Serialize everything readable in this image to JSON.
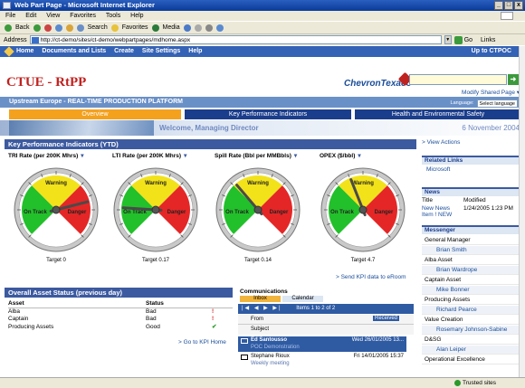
{
  "window": {
    "title": "Web Part Page - Microsoft Internet Explorer"
  },
  "menu": [
    "File",
    "Edit",
    "View",
    "Favorites",
    "Tools",
    "Help"
  ],
  "toolbar": {
    "back": "Back",
    "search": "Search",
    "favorites": "Favorites",
    "media": "Media"
  },
  "address": {
    "label": "Address",
    "url": "http://ct-demo/sites/ct-demo/webpartpages/mdhome.aspx",
    "go": "Go",
    "links": "Links"
  },
  "topnav": {
    "items": [
      "Home",
      "Documents and Lists",
      "Create",
      "Site Settings",
      "Help"
    ],
    "up": "Up to CTPOC"
  },
  "brand": {
    "title": "CTUE - RtPP",
    "logo_text": "ChevronTexaco"
  },
  "modify": "Modify Shared Page ▾",
  "platform": {
    "title": "Upstream Europe - REAL-TIME PRODUCTION PLATFORM",
    "language_label": "Language:",
    "language_value": "Select language"
  },
  "tabs": [
    "Overview",
    "Key Performance Indicators",
    "Health and Environmental Safety"
  ],
  "welcome": {
    "text": "Welcome, Managing Director",
    "date": "6 November 2004"
  },
  "kpi": {
    "title": "Key Performance Indicators (YTD)",
    "gauges": [
      {
        "title": "TRI Rate (per 200K Mhrs)",
        "target": "Target 0",
        "value": 0.78
      },
      {
        "title": "LTI Rate (per 200K Mhrs)",
        "target": "Target 0.17",
        "value": 0.18
      },
      {
        "title": "Spill Rate (Bbl per MMBbls)",
        "target": "Target 0.14",
        "value": 0.35
      },
      {
        "title": "OPEX ($/bbl)",
        "target": "Target 4.7",
        "value": 0.42
      }
    ],
    "zone_labels": {
      "green": "On Track",
      "yellow": "Warning",
      "red": "Danger"
    },
    "send_link": "> Send KPI data to eRoom"
  },
  "assets": {
    "title": "Overall Asset Status (previous day)",
    "headers": [
      "Asset",
      "Status"
    ],
    "rows": [
      {
        "asset": "Alba",
        "status": "Bad",
        "icon": "!"
      },
      {
        "asset": "Captain",
        "status": "Bad",
        "icon": "!"
      },
      {
        "asset": "Producing Assets",
        "status": "Good",
        "icon": "✔"
      }
    ],
    "link": "> Go to KPI Home"
  },
  "comm": {
    "title": "Communications",
    "tabs": [
      "Inbox",
      "Calendar"
    ],
    "items_label": "Items 1 to 2 of 2",
    "from": "From",
    "received": "Received",
    "subject": "Subject",
    "mails": [
      {
        "from": "Ed Santousso",
        "date": "Wed 26/01/2005 13...",
        "subject": "POC Demonstration"
      },
      {
        "from": "Stephane Rioux",
        "date": "Fri 14/01/2005 15:37",
        "subject": "Weekly meeting"
      }
    ]
  },
  "sidebar": {
    "view_actions": "> View Actions",
    "related_title": "Related Links",
    "related": [
      "Microsoft"
    ],
    "news_title": "News",
    "news_headers": [
      "Title",
      "Modified"
    ],
    "news": [
      {
        "title": "New News Item ! NEW",
        "modified": "1/24/2005 1:23 PM"
      }
    ],
    "messenger_title": "Messenger",
    "messenger": [
      {
        "name": "General Manager",
        "child": false
      },
      {
        "name": "Brian Smith",
        "child": true
      },
      {
        "name": "Alba Asset",
        "child": false
      },
      {
        "name": "Brian Wardrope",
        "child": true
      },
      {
        "name": "Captain Asset",
        "child": false
      },
      {
        "name": "Mike Bonner",
        "child": true
      },
      {
        "name": "Producing Assets",
        "child": false
      },
      {
        "name": "Richard Pearce",
        "child": true
      },
      {
        "name": "Value Creation",
        "child": false
      },
      {
        "name": "Rosemary Johnson-Sabine",
        "child": true
      },
      {
        "name": "D&SG",
        "child": false
      },
      {
        "name": "Alan Leiper",
        "child": true
      },
      {
        "name": "Operational Excellence",
        "child": false
      }
    ]
  },
  "status": {
    "zone": "Trusted sites"
  },
  "colors": {
    "green": "#22c02a",
    "yellow": "#f2e21a",
    "red": "#e52626",
    "nav": "#3462b5",
    "accent": "#f4a11e"
  }
}
